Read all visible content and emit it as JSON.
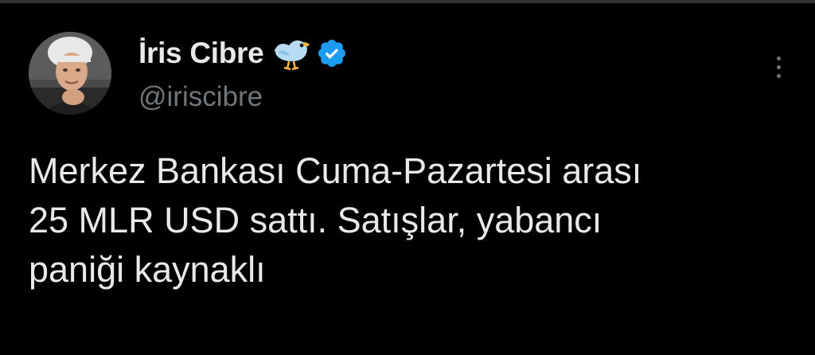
{
  "author": {
    "display_name": "İris Cibre",
    "handle": "@iriscibre",
    "name_emoji": "bird-emoji",
    "verified_icon": "verified-badge-icon"
  },
  "tweet": {
    "text_lines": [
      "Merkez Bankası Cuma-Pazartesi arası",
      "25 MLR USD sattı. Satışlar, yabancı",
      "paniği kaynaklı"
    ]
  },
  "menu": {
    "icon": "more-options-icon"
  },
  "colors": {
    "background": "#000000",
    "text_primary": "#e7e9ea",
    "text_secondary": "#71767b",
    "verified_blue": "#1d9bf0",
    "divider": "#2f3336"
  }
}
